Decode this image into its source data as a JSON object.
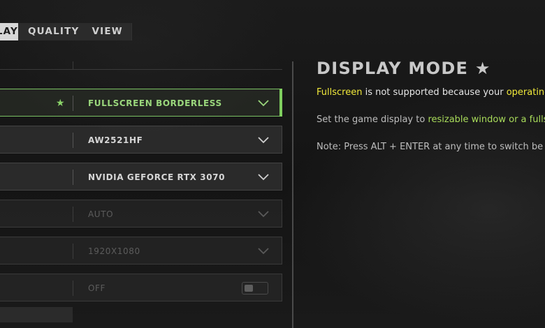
{
  "tabs": [
    {
      "label": "DISPLAY",
      "active": true
    },
    {
      "label": "QUALITY",
      "active": false
    },
    {
      "label": "VIEW",
      "active": false
    }
  ],
  "settings": [
    {
      "value": "FULLSCREEN BORDERLESS",
      "starred": true,
      "control": "dropdown",
      "state": "selected"
    },
    {
      "value": "AW2521HF",
      "starred": false,
      "control": "dropdown",
      "state": "normal"
    },
    {
      "value": "NVIDIA GEFORCE RTX 3070",
      "starred": false,
      "control": "dropdown",
      "state": "normal"
    },
    {
      "value": "AUTO",
      "starred": false,
      "control": "dropdown",
      "state": "disabled"
    },
    {
      "value": "1920X1080",
      "starred": false,
      "control": "dropdown",
      "state": "disabled"
    },
    {
      "value": "OFF",
      "starred": false,
      "control": "toggle",
      "state": "disabled"
    }
  ],
  "info": {
    "title": "DISPLAY MODE ★",
    "line1": {
      "part1": "Fullscreen",
      "part2": " is not supported because your ",
      "part3": "operating"
    },
    "line2": {
      "part1": "Set the game display to ",
      "part2": "resizable window or a fullsc"
    },
    "line3": "Note: Press ALT + ENTER at any time to switch be"
  },
  "colors": {
    "accent_green": "#7fcf5f",
    "highlight_yellow": "#f0e83a",
    "highlight_green": "#a8db5a"
  },
  "icons": {
    "star": "star-icon",
    "dropdown": "chevron-down-icon",
    "toggle": "toggle-switch"
  }
}
